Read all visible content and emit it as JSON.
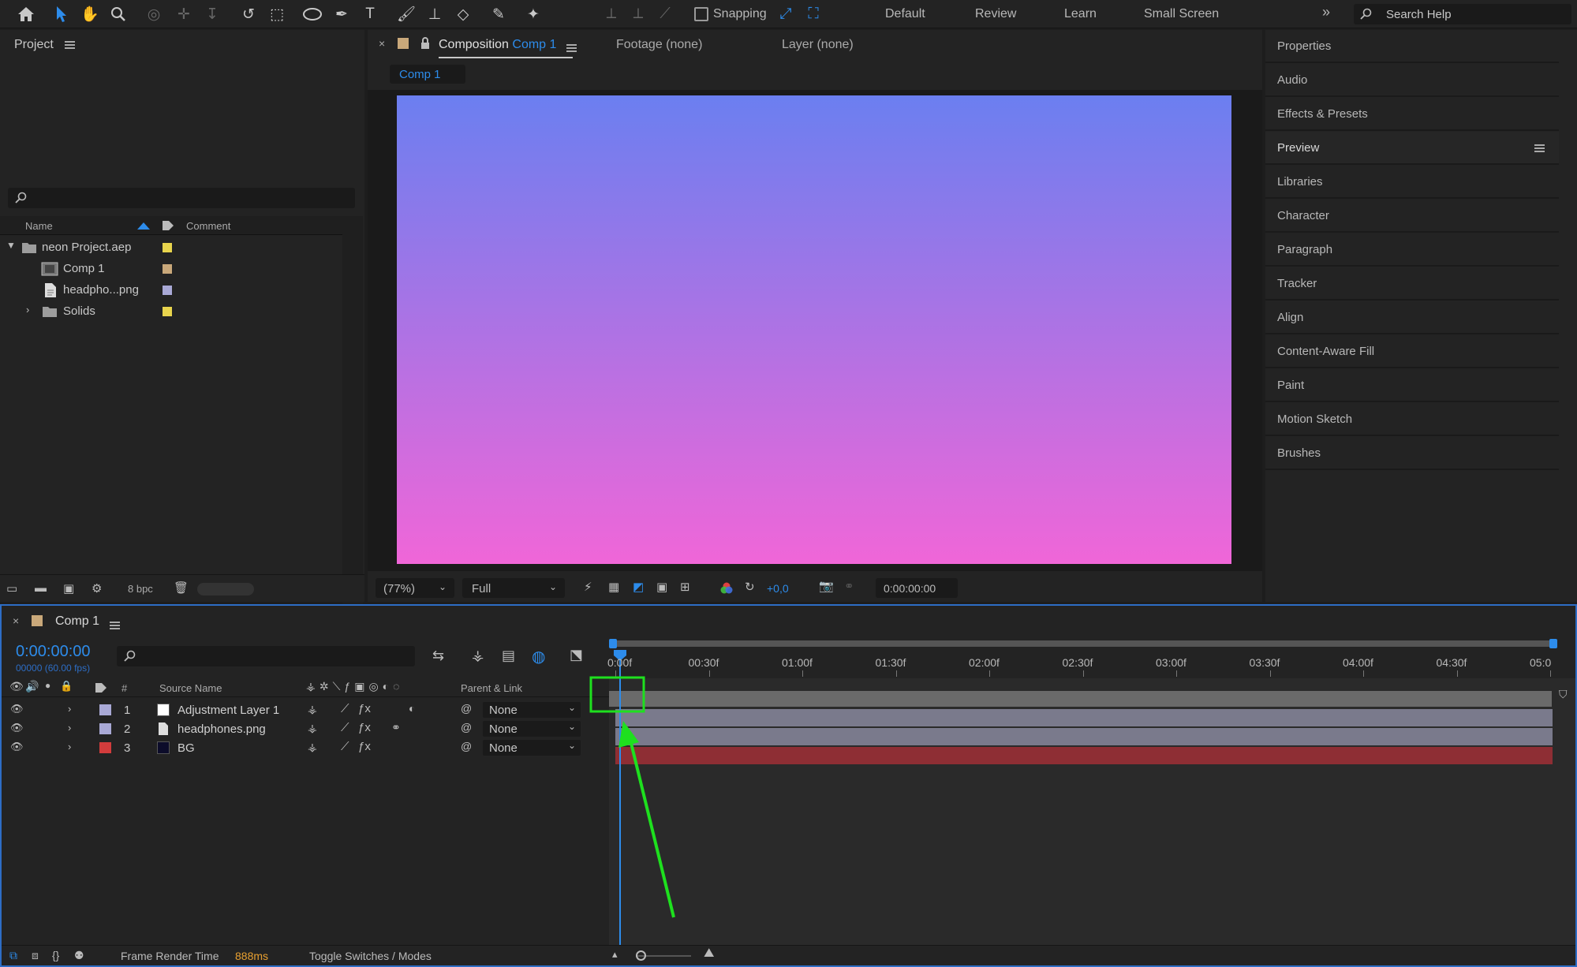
{
  "toolbar": {
    "snapping_label": "Snapping",
    "workspaces": [
      "Default",
      "Review",
      "Learn",
      "Small Screen"
    ],
    "search_placeholder": "Search Help"
  },
  "project": {
    "title": "Project",
    "columns": {
      "name": "Name",
      "comment": "Comment"
    },
    "items": [
      {
        "label": "neon Project.aep",
        "color": "#e8d44d",
        "kind": "folder",
        "expanded": true
      },
      {
        "label": "Comp 1",
        "color": "#c9a87a",
        "kind": "comp"
      },
      {
        "label": "headpho...png",
        "color": "#a9a9d6",
        "kind": "file"
      },
      {
        "label": "Solids",
        "color": "#e8d44d",
        "kind": "folder",
        "expanded": false
      }
    ],
    "bpc": "8 bpc"
  },
  "composition": {
    "tab_prefix": "Composition",
    "tab_name": "Comp 1",
    "footage_tab": "Footage (none)",
    "layer_tab": "Layer (none)",
    "subtab": "Comp 1",
    "zoom": "(77%)",
    "resolution": "Full",
    "exposure": "+0,0",
    "timecode": "0:00:00:00",
    "gradient_top": "#6b7ff0",
    "gradient_bottom": "#f066d8"
  },
  "right_panel": {
    "items": [
      "Properties",
      "Audio",
      "Effects & Presets",
      "Preview",
      "Libraries",
      "Character",
      "Paragraph",
      "Tracker",
      "Align",
      "Content-Aware Fill",
      "Paint",
      "Motion Sketch",
      "Brushes"
    ]
  },
  "timeline": {
    "tab": "Comp 1",
    "current_time": "0:00:00:00",
    "frame_info": "00000 (60.00 fps)",
    "columns": {
      "num": "#",
      "source": "Source Name",
      "parent": "Parent & Link"
    },
    "ruler": [
      "0:00f",
      "00:30f",
      "01:00f",
      "01:30f",
      "02:00f",
      "02:30f",
      "03:00f",
      "03:30f",
      "04:00f",
      "04:30f",
      "05:0"
    ],
    "layers": [
      {
        "num": "1",
        "name": "Adjustment Layer 1",
        "label_color": "#a9a9d6",
        "thumb": "#ffffff",
        "parent": "None",
        "bar_color": "#7a7a8c"
      },
      {
        "num": "2",
        "name": "headphones.png",
        "label_color": "#a9a9d6",
        "thumb": "file",
        "parent": "None",
        "bar_color": "#7a7a8c"
      },
      {
        "num": "3",
        "name": "BG",
        "label_color": "#d23c3c",
        "thumb": "#0c0c2a",
        "parent": "None",
        "bar_color": "#8e2e34"
      }
    ],
    "status": {
      "frame_render_label": "Frame Render Time",
      "frame_render_value": "888ms",
      "toggle_label": "Toggle Switches / Modes"
    }
  },
  "annotation": {
    "color": "#1ee01e"
  }
}
